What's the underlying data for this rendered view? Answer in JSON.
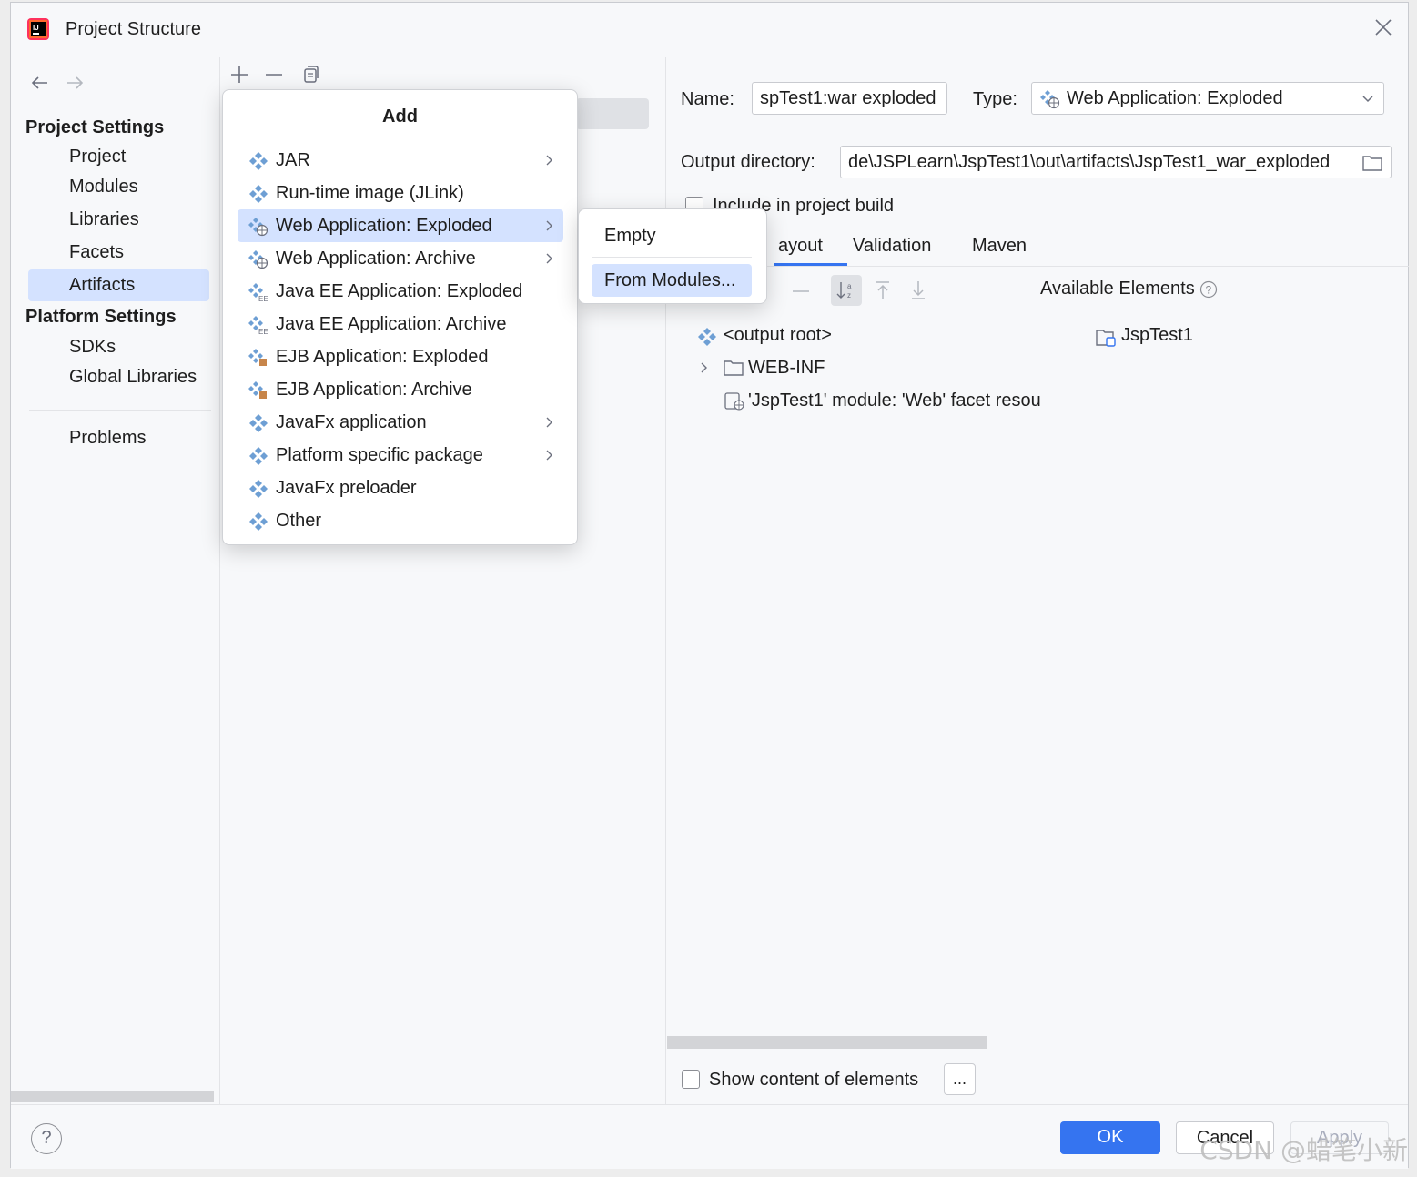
{
  "window": {
    "title": "Project Structure"
  },
  "nav": {
    "groups": [
      {
        "label": "Project Settings",
        "items": [
          "Project",
          "Modules",
          "Libraries",
          "Facets",
          "Artifacts"
        ]
      },
      {
        "label": "Platform Settings",
        "items": [
          "SDKs",
          "Global Libraries"
        ]
      }
    ],
    "problems": "Problems",
    "selected": "Artifacts"
  },
  "toolbar": {
    "add": "add-icon",
    "remove": "remove-icon",
    "copy": "copy-icon"
  },
  "add_popup": {
    "title": "Add",
    "items": [
      {
        "label": "JAR",
        "submenu": true
      },
      {
        "label": "Run-time image (JLink)",
        "submenu": false
      },
      {
        "label": "Web Application: Exploded",
        "submenu": true,
        "highlighted": true
      },
      {
        "label": "Web Application: Archive",
        "submenu": true
      },
      {
        "label": "Java EE Application: Exploded",
        "submenu": false
      },
      {
        "label": "Java EE Application: Archive",
        "submenu": false
      },
      {
        "label": "EJB Application: Exploded",
        "submenu": false
      },
      {
        "label": "EJB Application: Archive",
        "submenu": false
      },
      {
        "label": "JavaFx application",
        "submenu": true
      },
      {
        "label": "Platform specific package",
        "submenu": true
      },
      {
        "label": "JavaFx preloader",
        "submenu": false
      },
      {
        "label": "Other",
        "submenu": false
      }
    ]
  },
  "submenu": {
    "items": [
      "Empty",
      "From Modules..."
    ],
    "highlighted": "From Modules..."
  },
  "artifact": {
    "name_label": "Name:",
    "name_value": "spTest1:war exploded",
    "type_label": "Type:",
    "type_value": "Web Application: Exploded",
    "output_label": "Output directory:",
    "output_value": "de\\JSPLearn\\JspTest1\\out\\artifacts\\JspTest1_war_exploded",
    "include_label": "Include in project build",
    "tabs": [
      "ayout",
      "Validation",
      "Maven"
    ],
    "available_label": "Available Elements",
    "tree": [
      "<output root>",
      "WEB-INF",
      "'JspTest1' module: 'Web' facet resou"
    ],
    "available_tree": [
      "JspTest1"
    ],
    "show_content_label": "Show content of elements",
    "ellipsis": "..."
  },
  "buttons": {
    "help": "?",
    "ok": "OK",
    "cancel": "Cancel",
    "apply": "Apply"
  },
  "watermark": "CSDN @蜡笔小新",
  "colors": {
    "accent": "#3574f0",
    "selection": "#d4e2ff"
  }
}
